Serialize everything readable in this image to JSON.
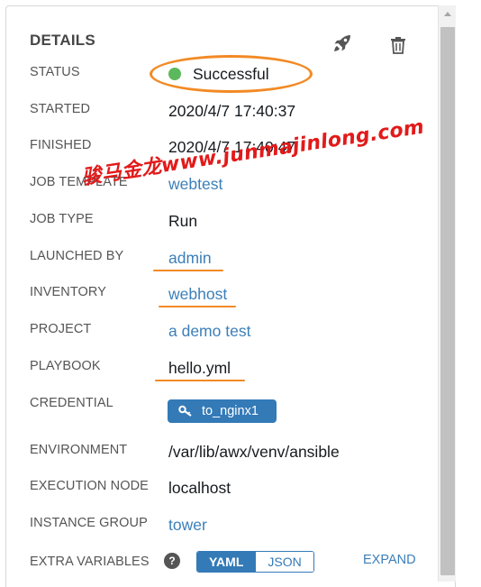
{
  "header": {
    "title": "DETAILS",
    "icons": {
      "launch": "rocket-icon",
      "delete": "trash-icon"
    }
  },
  "details": {
    "status": {
      "label": "STATUS",
      "value": "Successful",
      "color": "#5cb85c"
    },
    "started": {
      "label": "STARTED",
      "value": "2020/4/7 17:40:37"
    },
    "finished": {
      "label": "FINISHED",
      "value": "2020/4/7 17:40:47"
    },
    "job_template": {
      "label": "JOB TEMPLATE",
      "value": "webtest"
    },
    "job_type": {
      "label": "JOB TYPE",
      "value": "Run"
    },
    "launched_by": {
      "label": "LAUNCHED BY",
      "value": "admin"
    },
    "inventory": {
      "label": "INVENTORY",
      "value": "webhost"
    },
    "project": {
      "label": "PROJECT",
      "value": "a demo test"
    },
    "playbook": {
      "label": "PLAYBOOK",
      "value": "hello.yml"
    },
    "credential": {
      "label": "CREDENTIAL",
      "value": "to_nginx1",
      "icon": "key-icon"
    },
    "environment": {
      "label": "ENVIRONMENT",
      "value": "/var/lib/awx/venv/ansible"
    },
    "execution_node": {
      "label": "EXECUTION NODE",
      "value": "localhost"
    },
    "instance_group": {
      "label": "INSTANCE GROUP",
      "value": "tower"
    },
    "extra_variables": {
      "label": "EXTRA VARIABLES",
      "help": "?",
      "toggle": {
        "yaml": "YAML",
        "json": "JSON",
        "selected": "YAML"
      },
      "expand": "EXPAND"
    }
  },
  "watermark": {
    "text": "骏马金龙www.junmajinlong.com"
  },
  "annotation_color": "#f28a25"
}
